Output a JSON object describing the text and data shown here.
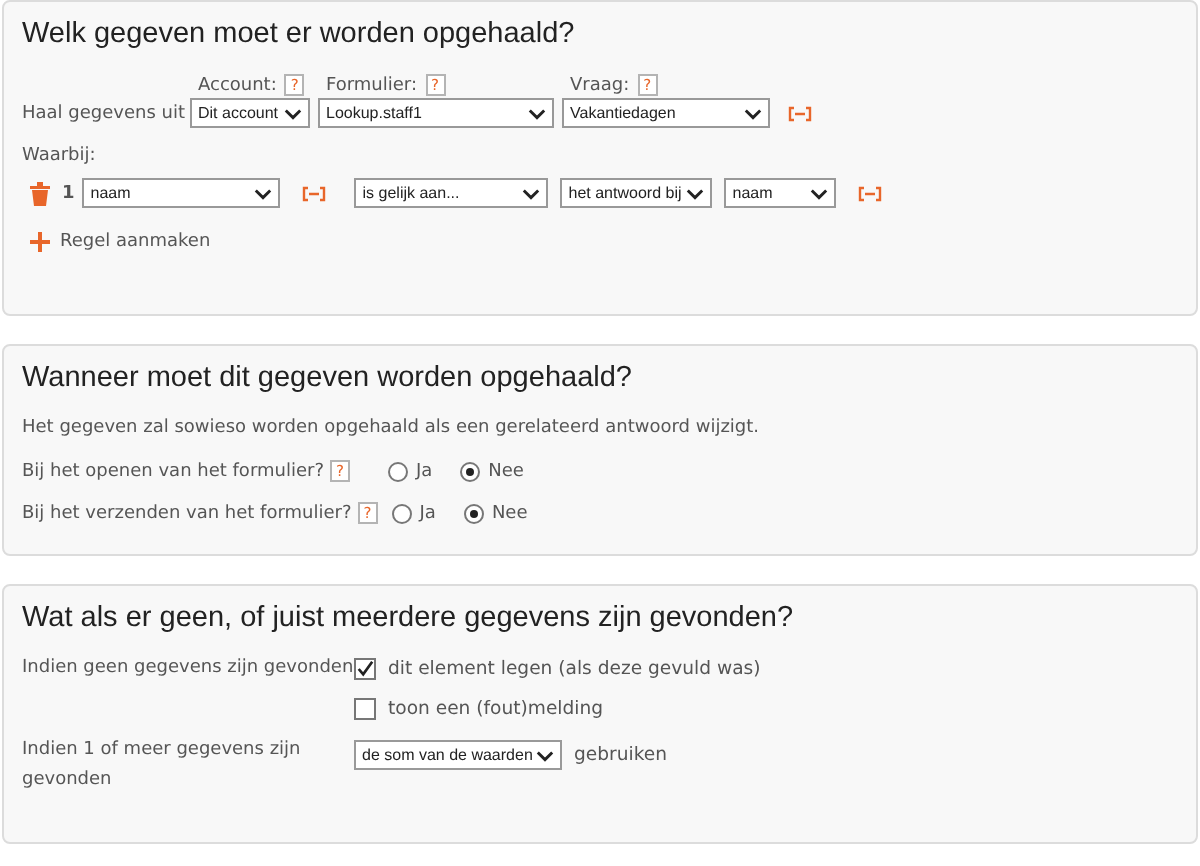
{
  "source": {
    "title": "Welk gegeven moet er worden opgehaald?",
    "label": "Haal gegevens uit",
    "fields": [
      {
        "label": "Account:",
        "help": "?",
        "value": "Dit account"
      },
      {
        "label": "Formulier:",
        "help": "?",
        "value": "Lookup.staff1"
      },
      {
        "label": "Vraag:",
        "help": "?",
        "value": "Vakantiedagen"
      }
    ],
    "conditions_label": "Waarbij:",
    "conditions": [
      {
        "number": "1",
        "field": "naam",
        "operator": "is gelijk aan...",
        "value_source": "het antwoord bij",
        "value": "naam"
      }
    ],
    "add_label": "Regel aanmaken"
  },
  "timing": {
    "title": "Wanneer moet dit gegeven worden opgehaald?",
    "note": "Het gegeven zal sowieso worden opgehaald als een gerelateerd antwoord wijzigt.",
    "questions": [
      {
        "label": "Bij het openen van het formulier?",
        "help": "?",
        "options": [
          {
            "label": "Ja",
            "selected": false
          },
          {
            "label": "Nee",
            "selected": true
          }
        ]
      },
      {
        "label": "Bij het verzenden van het formulier?",
        "help": "?",
        "options": [
          {
            "label": "Ja",
            "selected": false
          },
          {
            "label": "Nee",
            "selected": true
          }
        ]
      }
    ]
  },
  "results": {
    "title": "Wat als er geen, of juist meerdere gegevens zijn gevonden?",
    "none_label": "Indien geen gegevens zijn gevonden",
    "none_options": [
      {
        "label": "dit element legen (als deze gevuld was)",
        "checked": true
      },
      {
        "label": "toon een (fout)melding",
        "checked": false
      }
    ],
    "many_label": "Indien 1 of meer gegevens zijn gevonden",
    "many_value": "de som van de waarden",
    "many_suffix": "gebruiken"
  }
}
